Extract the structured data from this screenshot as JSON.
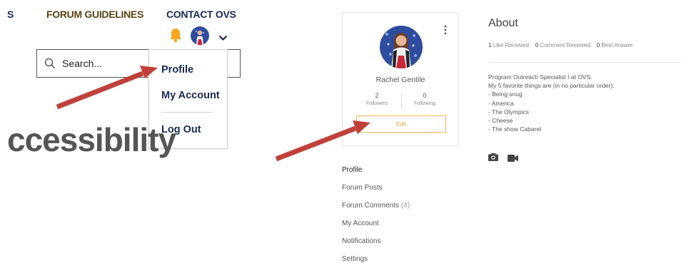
{
  "header": {
    "nav_partial": "S",
    "forum_guidelines": "FORUM GUIDELINES",
    "contact": "CONTACT OVS"
  },
  "search": {
    "placeholder": "Search..."
  },
  "user_menu": {
    "items": [
      {
        "label": "Profile"
      },
      {
        "label": "My Account"
      },
      {
        "label": "Log Out"
      }
    ]
  },
  "hero": {
    "partial_text": "ccessibility"
  },
  "profile_card": {
    "name": "Rachel Gentile",
    "followers_count": "2",
    "followers_label": "Followers",
    "following_count": "0",
    "following_label": "Following",
    "edit_label": "Edit"
  },
  "sidebar": {
    "items": [
      {
        "label": "Profile",
        "count": ""
      },
      {
        "label": "Forum Posts",
        "count": ""
      },
      {
        "label": "Forum Comments",
        "count": "(4)"
      },
      {
        "label": "My Account",
        "count": ""
      },
      {
        "label": "Notifications",
        "count": ""
      },
      {
        "label": "Settings",
        "count": ""
      }
    ]
  },
  "about": {
    "title": "About",
    "likes_count": "1",
    "likes_label": "Like Received",
    "comments_count": "0",
    "comments_label": "Comment Received",
    "answers_count": "0",
    "answers_label": "Best Answer",
    "bio": [
      "Program Outreach Specialist I at OVS.",
      "My 5 favorite things are (in no particular order):",
      "- Being snug",
      "- America",
      "- The Olympics",
      "- Cheese",
      "- The show Cabaret"
    ]
  },
  "icons": {
    "bell": "bell-icon",
    "chevron": "chevron-down-icon",
    "search": "search-icon",
    "more": "more-vertical-icon",
    "camera": "camera-icon",
    "video": "video-icon",
    "arrow": "annotation-arrow"
  },
  "colors": {
    "nav_gold": "#5a4411",
    "navy": "#1a2a56",
    "bell": "#f5a623",
    "edit_accent": "#e99a35",
    "arrow_red": "#c0413a"
  }
}
